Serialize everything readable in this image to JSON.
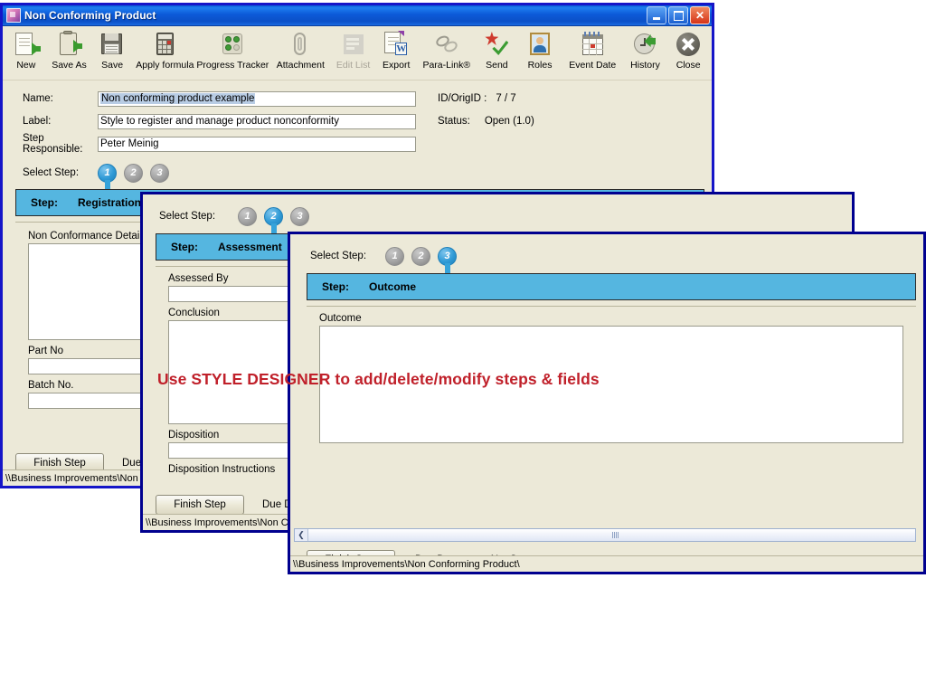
{
  "window1": {
    "title": "Non Conforming Product",
    "title_icon": "app-icon",
    "caption": {
      "minimize": "minimize-icon",
      "maximize": "maximize-icon",
      "close": "close-icon"
    },
    "toolbar": [
      {
        "label": "New",
        "icon": "new-document-icon",
        "disabled": false
      },
      {
        "label": "Save As",
        "icon": "save-as-icon",
        "disabled": false
      },
      {
        "label": "Save",
        "icon": "floppy-save-icon",
        "disabled": false
      },
      {
        "label": "Apply formula",
        "icon": "calculator-icon",
        "disabled": false
      },
      {
        "label": "Progress Tracker",
        "icon": "progress-tracker-icon",
        "disabled": false
      },
      {
        "label": "Attachment",
        "icon": "paperclip-icon",
        "disabled": false
      },
      {
        "label": "Edit List",
        "icon": "edit-list-icon",
        "disabled": true
      },
      {
        "label": "Export",
        "icon": "export-word-icon",
        "disabled": false
      },
      {
        "label": "Para-Link®",
        "icon": "para-link-chain-icon",
        "disabled": false
      },
      {
        "label": "Send",
        "icon": "send-check-icon",
        "disabled": false
      },
      {
        "label": "Roles",
        "icon": "roles-person-icon",
        "disabled": false
      },
      {
        "label": "Event Date",
        "icon": "calendar-icon",
        "disabled": false
      },
      {
        "label": "History",
        "icon": "history-clock-icon",
        "disabled": false
      },
      {
        "label": "Close",
        "icon": "close-x-icon",
        "disabled": false
      }
    ],
    "fields": {
      "name_label": "Name:",
      "name_value": "Non conforming product example",
      "label_label": "Label:",
      "label_value": "Style to register and manage product nonconformity",
      "responsible_label": "Step Responsible:",
      "responsible_value": "Peter Meinig",
      "idorig_label": "ID/OrigID :",
      "idorig_value": "7 / 7",
      "status_label": "Status:",
      "status_value": "Open (1.0)"
    },
    "select_step_label": "Select Step:",
    "steps": [
      "1",
      "2",
      "3"
    ],
    "active_step": 1,
    "step_bar": {
      "prefix": "Step:",
      "name": "Registration",
      "dropdown": "chevron-down-icon"
    },
    "panel_fields": [
      {
        "label": "Non Conformance Details",
        "type": "textarea"
      },
      {
        "label": "Part No",
        "type": "text"
      },
      {
        "label": "Batch No.",
        "type": "text"
      }
    ],
    "finish_button": "Finish Step",
    "due_date_label": "Due Da",
    "statusbar": "\\\\Business Improvements\\Non C"
  },
  "window2": {
    "select_step_label": "Select Step:",
    "steps": [
      "1",
      "2",
      "3"
    ],
    "active_step": 2,
    "step_bar": {
      "prefix": "Step:",
      "name": "Assessment"
    },
    "panel_fields": [
      {
        "label": "Assessed By",
        "type": "text"
      },
      {
        "label": "Conclusion",
        "type": "textarea"
      },
      {
        "label": "Disposition",
        "type": "text"
      },
      {
        "label": "Disposition Instructions",
        "type": "label-only"
      }
    ],
    "finish_button": "Finish Step",
    "due_date_label": "Due Date",
    "statusbar": "\\\\Business Improvements\\Non Cor"
  },
  "window3": {
    "select_step_label": "Select Step:",
    "steps": [
      "1",
      "2",
      "3"
    ],
    "active_step": 3,
    "step_bar": {
      "prefix": "Step:",
      "name": "Outcome"
    },
    "panel_fields": [
      {
        "label": "Outcome",
        "type": "textarea"
      }
    ],
    "scrollbar": {
      "left_arrow": "chevron-left-icon"
    },
    "finish_button": "Finish Step",
    "due_date_label": "Due Date:",
    "due_date_value": "Not Set",
    "statusbar": "\\\\Business Improvements\\Non Conforming Product\\"
  },
  "annotation": {
    "text": "Use STYLE DESIGNER to add/delete/modify steps & fields",
    "color": "#c0202a"
  },
  "colors": {
    "window_frame_blue": "#1515c8",
    "window_frame_navy": "#00008f",
    "titlebar_blue": "#0c5ad8",
    "step_bar_cyan": "#55b6e0",
    "active_step_blue": "#2f9ad6",
    "form_background": "#ece9d8",
    "field_white": "#ffffff",
    "selection_blue": "#b8cce4",
    "annotation_red": "#c0202a"
  }
}
